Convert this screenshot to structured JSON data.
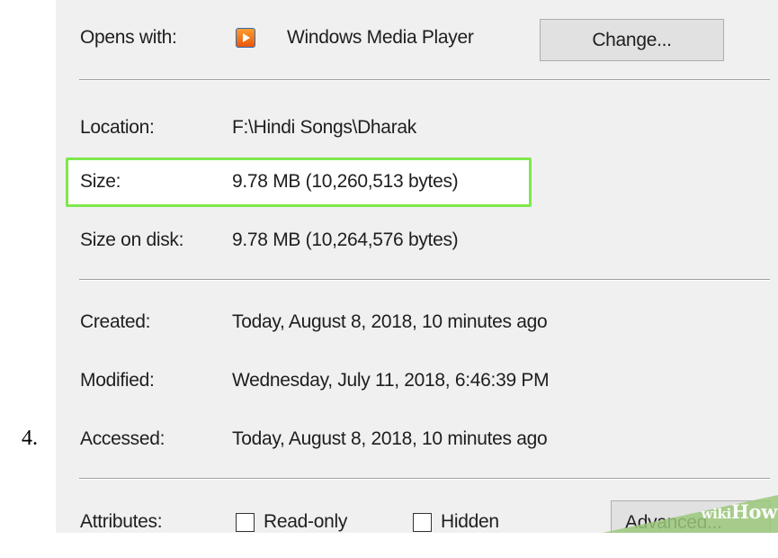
{
  "step_number": "4.",
  "opens_with": {
    "label": "Opens with:",
    "app_name": "Windows Media Player",
    "app_icon": "windows-media-player-icon",
    "change_button": "Change..."
  },
  "location": {
    "label": "Location:",
    "value": "F:\\Hindi Songs\\Dharak"
  },
  "size": {
    "label": "Size:",
    "value": "9.78 MB (10,260,513 bytes)",
    "highlight_color": "#7ee84d"
  },
  "size_on_disk": {
    "label": "Size on disk:",
    "value": "9.78 MB (10,264,576 bytes)"
  },
  "created": {
    "label": "Created:",
    "value": "Today, August 8, 2018, 10 minutes ago"
  },
  "modified": {
    "label": "Modified:",
    "value": "Wednesday, July 11, 2018, 6:46:39 PM"
  },
  "accessed": {
    "label": "Accessed:",
    "value": "Today, August 8, 2018, 10 minutes ago"
  },
  "attributes": {
    "label": "Attributes:",
    "read_only": {
      "label": "Read-only",
      "checked": false
    },
    "hidden": {
      "label": "Hidden",
      "checked": false
    },
    "advanced_button": "Advanced..."
  },
  "watermark": {
    "wiki": "wiki",
    "how": "How",
    "color": "#9bc87b"
  }
}
